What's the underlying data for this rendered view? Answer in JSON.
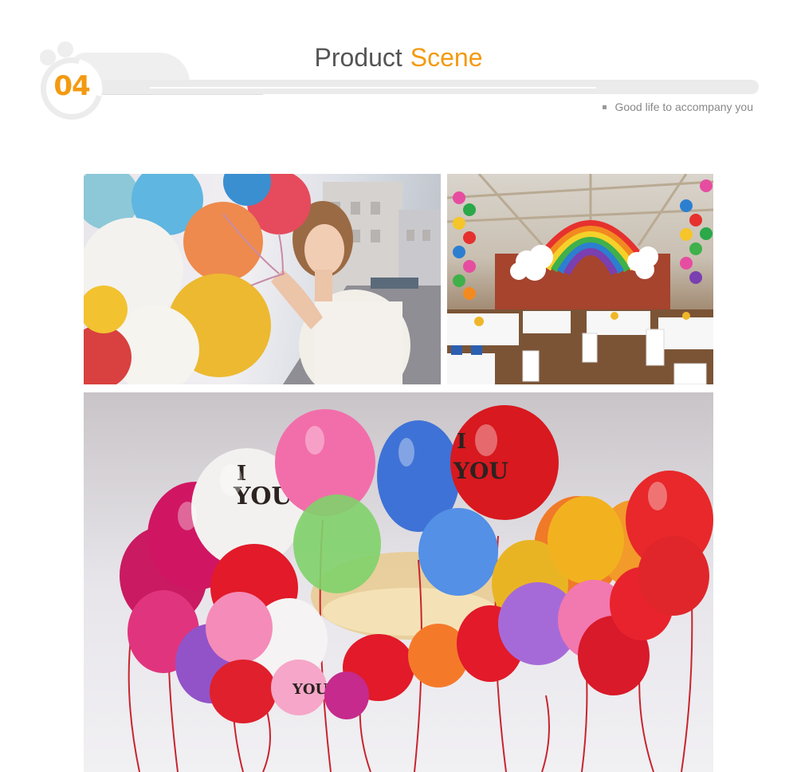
{
  "header": {
    "section_number": "04",
    "title_word1": "Product",
    "title_word2": "Scene",
    "subtitle": "Good life to accompany you"
  },
  "colors": {
    "accent": "#f39a10",
    "title_grey": "#555555",
    "subtitle_grey": "#888888",
    "deco_grey": "#ebebeb"
  },
  "photos": {
    "ceiling_balloon_text_1": "I",
    "ceiling_balloon_text_2": "YOU",
    "ceiling_balloon_text_3": "I",
    "ceiling_balloon_text_4": "YOU",
    "ceiling_balloon_text_5": "YOU"
  }
}
